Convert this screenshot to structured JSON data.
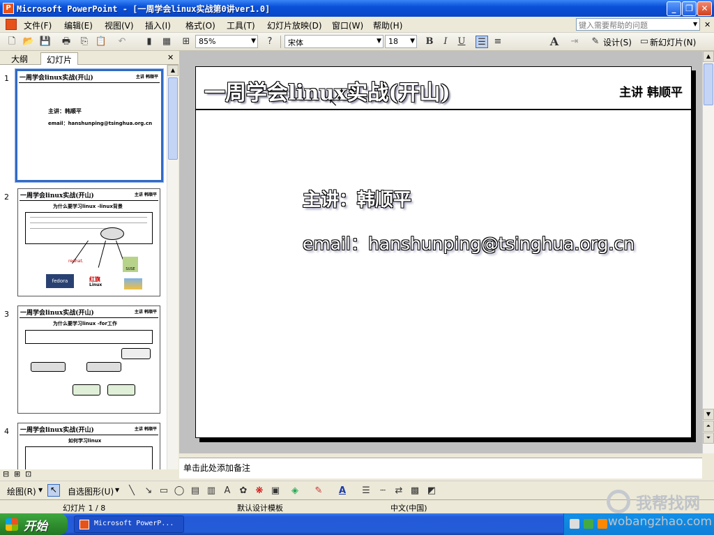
{
  "window": {
    "title": "Microsoft PowerPoint - [一周学会linux实战第0讲ver1.0]"
  },
  "menu": [
    "文件(F)",
    "编辑(E)",
    "视图(V)",
    "插入(I)",
    "格式(O)",
    "工具(T)",
    "幻灯片放映(D)",
    "窗口(W)",
    "帮助(H)"
  ],
  "help_placeholder": "键入需要帮助的问题",
  "toolbar": {
    "zoom": "85%",
    "font": "宋体",
    "font_size": "18",
    "bold": "B",
    "italic": "I",
    "underline": "U",
    "design": "设计(S)",
    "new_slide": "新幻灯片(N)",
    "font_icon": "A"
  },
  "panel": {
    "tab_outline": "大纲",
    "tab_slides": "幻灯片"
  },
  "thumbnails": [
    {
      "num": "1",
      "title": "一周学会linux实战(开山)",
      "speaker": "主讲 韩顺平",
      "lines": [
        "主讲：韩顺平",
        "email：hanshunping@tsinghua.org.cn"
      ]
    },
    {
      "num": "2",
      "title": "一周学会linux实战(开山)",
      "speaker": "主讲 韩顺平",
      "subtitle": "为什么要学习linux -linux背景",
      "logos": [
        "redhat.",
        "fedora",
        "红旗",
        "Linux",
        "SUSE"
      ]
    },
    {
      "num": "3",
      "title": "一周学会linux实战(开山)",
      "speaker": "主讲 韩顺平",
      "subtitle": "为什么要学习linux -for工作"
    },
    {
      "num": "4",
      "title": "一周学会linux实战(开山)",
      "speaker": "主讲 韩顺平",
      "subtitle": "如何学习linux"
    }
  ],
  "slide": {
    "title": "一周学会linux实战(开山)",
    "speaker": "主讲 韩顺平",
    "lecturer": "主讲：韩顺平",
    "email": "email：hanshunping@tsinghua.org.cn"
  },
  "notes_placeholder": "单击此处添加备注",
  "drawing": {
    "draw": "绘图(R)",
    "autoshape": "自选图形(U)"
  },
  "status": {
    "slide": "幻灯片 1 / 8",
    "template": "默认设计模板",
    "language": "中文(中国)"
  },
  "taskbar": {
    "start": "开始",
    "task": "Microsoft PowerP..."
  },
  "watermark": {
    "text": "我帮找网",
    "url": "wobangzhao.com"
  }
}
